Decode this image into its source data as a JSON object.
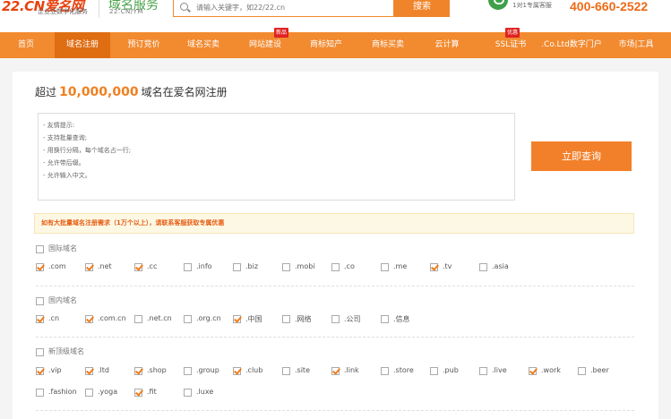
{
  "header": {
    "logo_text": "22.CN爱名网",
    "logo_sub": "企业业数字化服务",
    "brand_title": "域名服务",
    "brand_sub": "22.CN/YM",
    "search_placeholder": "请输入关键字，如22/22.cn",
    "search_button": "搜索",
    "service_text": "1对1专属客服",
    "hotline": "400-660-2522"
  },
  "nav": {
    "items": [
      {
        "label": "首页"
      },
      {
        "label": "域名注册",
        "active": true
      },
      {
        "label": "预订竞价"
      },
      {
        "label": "域名买卖"
      },
      {
        "label": "网站建设",
        "badge": "新品"
      },
      {
        "label": "商标知产"
      },
      {
        "label": "商标买卖"
      },
      {
        "label": "云计算"
      },
      {
        "label": "SSL证书",
        "badge": "优惠"
      },
      {
        "label": ".Co.Ltd数字门户"
      },
      {
        "label": "市场|工具"
      }
    ]
  },
  "register": {
    "title_prefix": "超过",
    "title_number": "10,000,000",
    "title_suffix": "域名在爱名网注册",
    "hints": [
      "- 友情提示:",
      "- 支持批量查询;",
      "- 用换行分隔，每个域名占一行;",
      "- 允许带后缀。",
      "- 允许输入中文。"
    ],
    "query_button": "立即查询",
    "notice": "如有大批量域名注册需求（1万个以上），请联系客服获取专属优惠"
  },
  "groups": [
    {
      "title": "国际域名",
      "checked": false,
      "options": [
        {
          "label": ".com",
          "checked": true
        },
        {
          "label": ".net",
          "checked": true
        },
        {
          "label": ".cc",
          "checked": true
        },
        {
          "label": ".info",
          "checked": false
        },
        {
          "label": ".biz",
          "checked": false
        },
        {
          "label": ".mobi",
          "checked": false
        },
        {
          "label": ".co",
          "checked": false
        },
        {
          "label": ".me",
          "checked": false
        },
        {
          "label": ".tv",
          "checked": true
        },
        {
          "label": ".asia",
          "checked": false
        }
      ]
    },
    {
      "title": "国内域名",
      "checked": false,
      "options": [
        {
          "label": ".cn",
          "checked": true
        },
        {
          "label": ".com.cn",
          "checked": true
        },
        {
          "label": ".net.cn",
          "checked": false
        },
        {
          "label": ".org.cn",
          "checked": false
        },
        {
          "label": ".中国",
          "checked": true
        },
        {
          "label": ".网络",
          "checked": false
        },
        {
          "label": ".公司",
          "checked": false
        },
        {
          "label": ".信息",
          "checked": false
        }
      ]
    },
    {
      "title": "新顶级域名",
      "checked": false,
      "options": [
        {
          "label": ".vip",
          "checked": true
        },
        {
          "label": ".ltd",
          "checked": true
        },
        {
          "label": ".shop",
          "checked": true
        },
        {
          "label": ".group",
          "checked": false
        },
        {
          "label": ".club",
          "checked": true
        },
        {
          "label": ".site",
          "checked": false
        },
        {
          "label": ".link",
          "checked": true
        },
        {
          "label": ".store",
          "checked": false
        },
        {
          "label": ".pub",
          "checked": false
        },
        {
          "label": ".live",
          "checked": false
        },
        {
          "label": ".work",
          "checked": true
        },
        {
          "label": ".beer",
          "checked": false
        },
        {
          "label": ".fashion",
          "checked": false
        },
        {
          "label": ".yoga",
          "checked": false
        },
        {
          "label": ".fit",
          "checked": true
        },
        {
          "label": ".luxe",
          "checked": false
        }
      ]
    }
  ],
  "colors": {
    "accent": "#f28a2f",
    "nav_active": "#df6d12",
    "hotline": "#ee6a16",
    "brand_green": "#3ea04a"
  }
}
